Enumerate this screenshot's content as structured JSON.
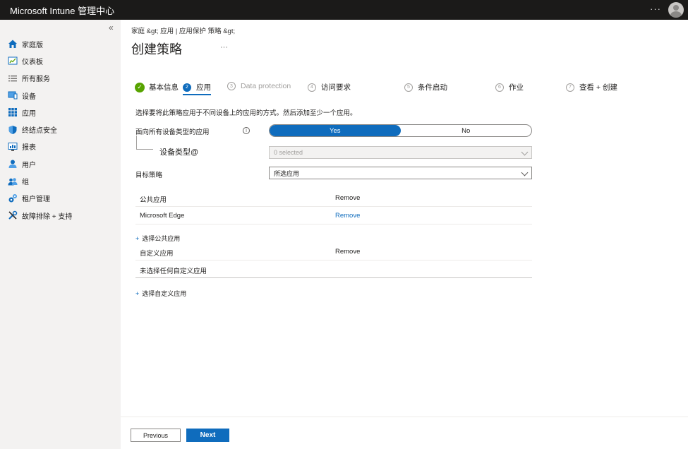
{
  "topbar": {
    "brand": "Microsoft Intune 管理中心",
    "more": "···"
  },
  "sidebar": {
    "collapse": "«",
    "items": [
      {
        "label": "家庭版",
        "icon": "home-icon"
      },
      {
        "label": "仪表板",
        "icon": "dashboard-icon"
      },
      {
        "label": "所有服务",
        "icon": "list-icon"
      },
      {
        "label": "设备",
        "icon": "devices-icon"
      },
      {
        "label": "应用",
        "icon": "apps-icon"
      },
      {
        "label": "终结点安全",
        "icon": "shield-icon"
      },
      {
        "label": "报表",
        "icon": "reports-icon"
      },
      {
        "label": "用户",
        "icon": "user-icon"
      },
      {
        "label": "组",
        "icon": "groups-icon"
      },
      {
        "label": "租户管理",
        "icon": "tenant-admin-icon"
      },
      {
        "label": "故障排除 + 支持",
        "icon": "troubleshoot-icon"
      }
    ]
  },
  "main": {
    "breadcrumb": "家庭 &gt;  应用 | 应用保护 策略 &gt;",
    "title": "创建策略",
    "title_more": "···",
    "steps": [
      {
        "num": "✓",
        "label": "基本信息"
      },
      {
        "num": "2",
        "label": "应用"
      },
      {
        "num": "3",
        "label": "Data protection"
      },
      {
        "num": "4",
        "label": "访问要求"
      },
      {
        "num": "5",
        "label": "条件启动"
      },
      {
        "num": "6",
        "label": "作业"
      },
      {
        "num": "7",
        "label": "查看 + 创建"
      }
    ],
    "description": "选择要将此策略应用于不同设备上的应用的方式。然后添加至少一个应用。",
    "target_all": {
      "label": "面向所有设备类型的应用",
      "info": "i",
      "yes": "Yes",
      "no": "No",
      "selected": "Yes"
    },
    "device_types": {
      "label": "设备类型@",
      "value": "0 selected"
    },
    "target_policy": {
      "label": "目标策略",
      "value": "所选应用"
    },
    "public_apps": {
      "header": "公共应用",
      "header_action": "Remove",
      "rows": [
        {
          "name": "Microsoft Edge",
          "action": "Remove"
        }
      ],
      "add_link": "选择公共应用"
    },
    "custom_apps": {
      "header": "自定义应用",
      "header_action": "Remove",
      "empty": "未选择任何自定义应用",
      "add_link": "选择自定义应用"
    },
    "footer": {
      "previous": "Previous",
      "next": "Next"
    }
  }
}
